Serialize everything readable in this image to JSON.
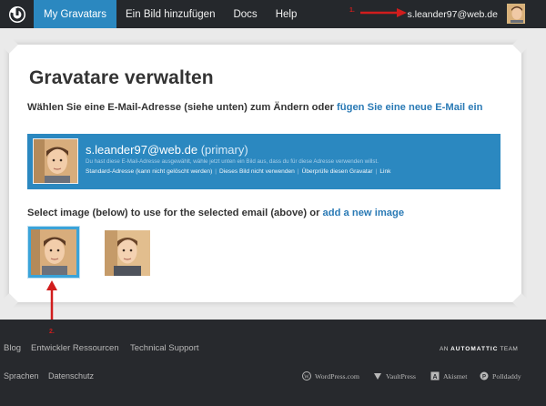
{
  "nav": {
    "items": [
      {
        "label": "My Gravatars",
        "active": true
      },
      {
        "label": "Ein Bild hinzufügen",
        "active": false
      },
      {
        "label": "Docs",
        "active": false
      },
      {
        "label": "Help",
        "active": false
      }
    ],
    "user_email": "s.leander97@web.de"
  },
  "main": {
    "title": "Gravatare verwalten",
    "instruction_text": "Wählen Sie eine E-Mail-Adresse (siehe unten) zum Ändern oder ",
    "instruction_link": "fügen Sie eine neue E-Mail ein",
    "email_card": {
      "email": "s.leander97@web.de",
      "primary_label": "(primary)",
      "description": "Du hast diese E-Mail-Adresse ausgewählt, wähle jetzt unten ein Bild aus, dass du für diese Adresse verwenden willst.",
      "links": [
        "Standard-Adresse (kann nicht gelöscht werden)",
        "Dieses Bild nicht verwenden",
        "Überprüfe diesen Gravatar",
        "Link"
      ]
    },
    "select_text": "Select image (below) to use for the selected email (above) or ",
    "select_link": "add a new image"
  },
  "annotations": {
    "arrow_1_label": "1.",
    "arrow_2_label": "2."
  },
  "footer": {
    "links_row1": [
      "Blog",
      "Entwickler Ressourcen",
      "Technical Support"
    ],
    "links_row2": [
      "Sprachen",
      "Datenschutz"
    ],
    "automattic_prefix": "AN",
    "automattic_name": "AUTOMATTIC",
    "automattic_suffix": "TEAM",
    "products": [
      "WordPress.com",
      "VaultPress",
      "Akismet",
      "Polldaddy"
    ]
  },
  "colors": {
    "accent_blue": "#2b88c0",
    "link_blue": "#2a7ab5",
    "topbar_bg": "#25282c",
    "footer_bg": "#27292d",
    "annotation_red": "#d11d1d"
  }
}
